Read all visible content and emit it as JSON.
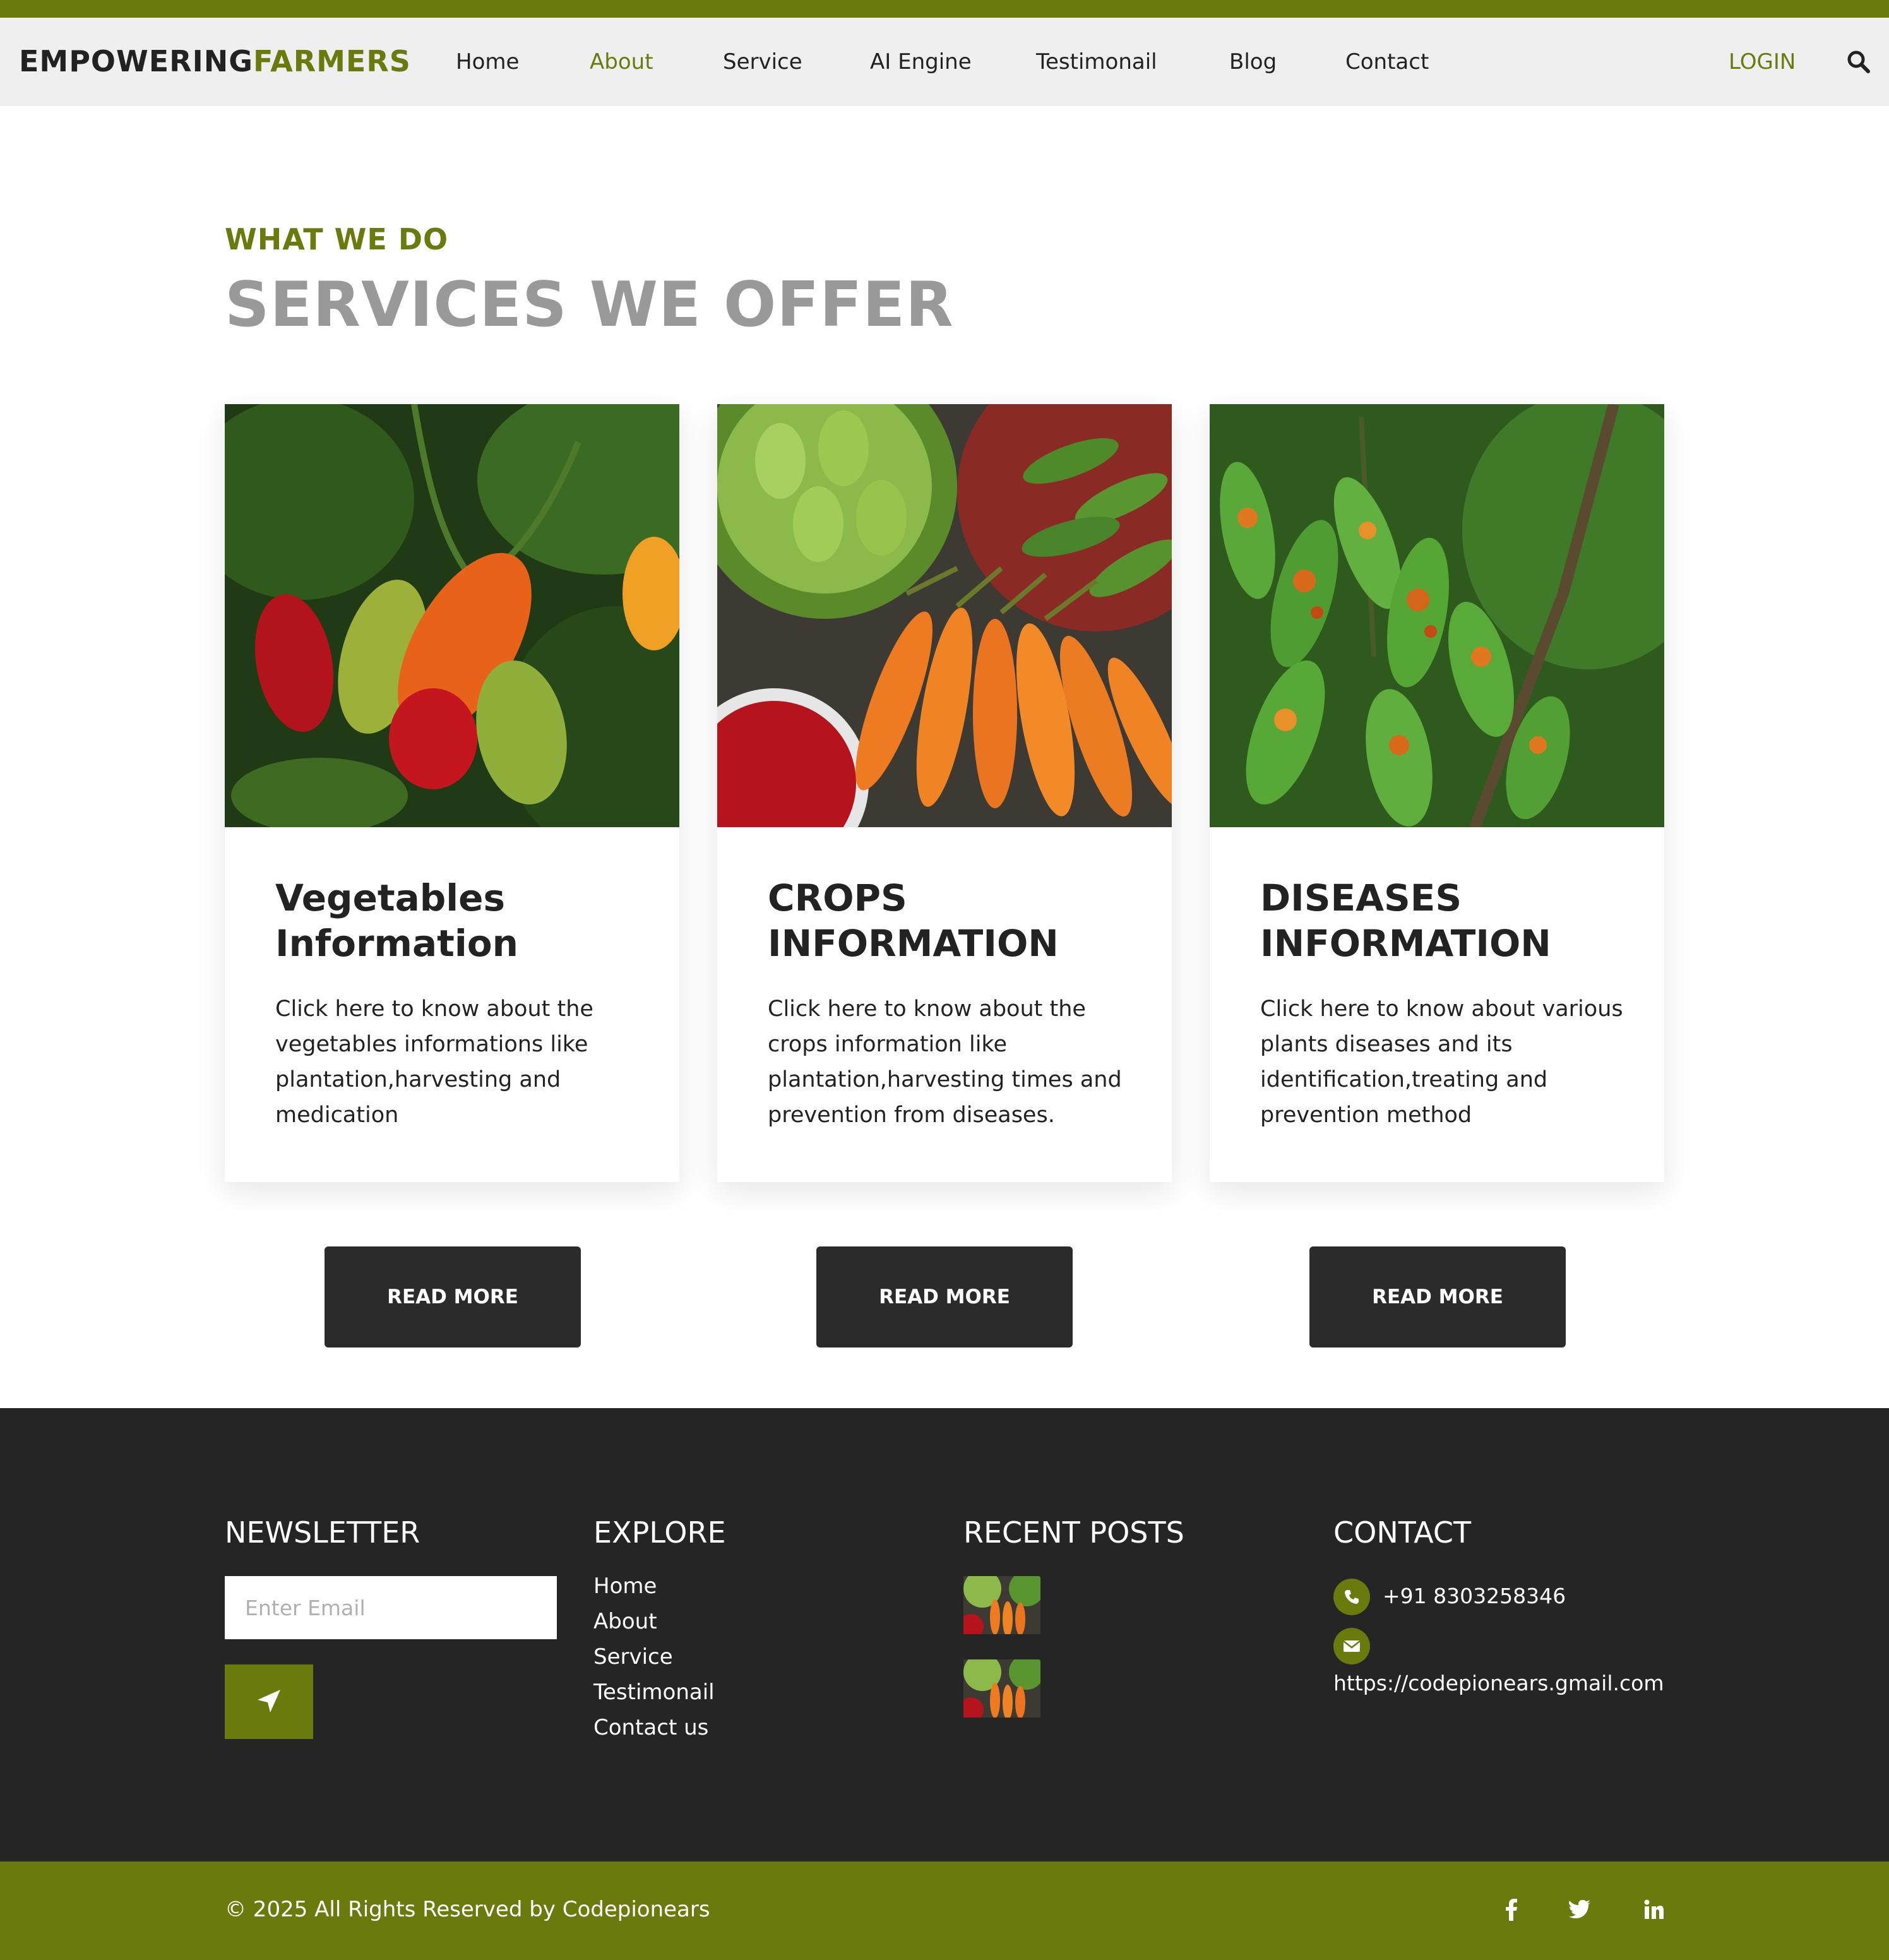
{
  "brand": {
    "part1": "EMPOWERING",
    "part2": "FARMERS"
  },
  "nav": {
    "items": [
      "Home",
      "About",
      "Service",
      "AI Engine",
      "Testimonail",
      "Blog",
      "Contact"
    ],
    "active": "About",
    "login": "LOGIN",
    "search_icon": "search-icon"
  },
  "section": {
    "eyebrow": "WHAT WE DO",
    "title": "SERVICES WE OFFER"
  },
  "cards": [
    {
      "title": "Vegetables Information",
      "text": "Click here to know about the vegetables informations like plantation,harvesting and medication",
      "button": "READ MORE",
      "image": "peppers-photo"
    },
    {
      "title": "CROPS INFORMATION",
      "text": "Click here to know about the crops information like plantation,harvesting times and prevention from diseases.",
      "button": "READ MORE",
      "image": "vegetables-market-photo"
    },
    {
      "title": "DISEASES INFORMATION",
      "text": "Click here to know about various plants diseases and its identification,treating and prevention method",
      "button": "READ MORE",
      "image": "diseased-leaves-photo"
    }
  ],
  "footer": {
    "newsletter": {
      "heading": "NEWSLETTER",
      "placeholder": "Enter Email",
      "send_icon": "send-icon"
    },
    "explore": {
      "heading": "EXPLORE",
      "links": [
        "Home",
        "About",
        "Service",
        "Testimonail",
        "Contact us"
      ]
    },
    "recent_posts": {
      "heading": "RECENT POSTS"
    },
    "contact": {
      "heading": "CONTACT",
      "phone": "+91 8303258346",
      "email": "https://codepionears.gmail.com",
      "phone_icon": "phone-icon",
      "email_icon": "envelope-icon"
    },
    "copyright": "© 2025 All Rights Reserved by Codepionears",
    "social_icons": [
      "facebook-icon",
      "twitter-icon",
      "linkedin-icon"
    ]
  },
  "colors": {
    "accent": "#6a7a0c",
    "dark": "#252525",
    "button": "#2b2b2b",
    "heading_gray": "#999999",
    "navbar_bg": "#efefef"
  }
}
